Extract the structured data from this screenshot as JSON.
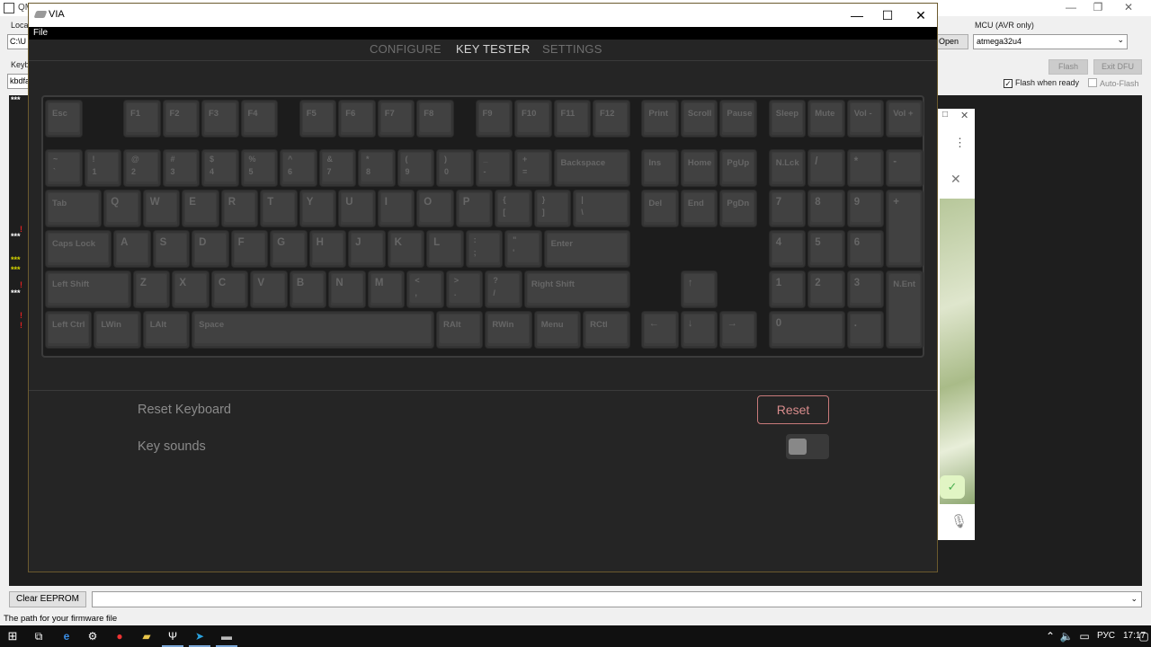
{
  "qmk": {
    "title": "QM",
    "label_local": "Loca",
    "path_value": "C:\\U",
    "label_keyboard": "Keyb",
    "keyboard_value": "kbdfa",
    "open_label": "Open",
    "mcu_label": "MCU (AVR only)",
    "mcu_value": "atmega32u4",
    "flash_label": "Flash",
    "exit_dfu_label": "Exit DFU",
    "flash_when_ready_label": "Flash when ready",
    "flash_when_ready_checked": true,
    "auto_flash_label": "Auto-Flash",
    "clear_eeprom_label": "Clear EEPROM",
    "status_text": "The path for your firmware file",
    "console_marks": [
      "***",
      "!",
      "***",
      "***",
      "***",
      "!",
      "***",
      "!",
      "!"
    ]
  },
  "via": {
    "title": "VIA",
    "menu_file": "File",
    "nav": [
      "CONFIGURE",
      "KEY TESTER",
      "SETTINGS"
    ],
    "active_tab": "KEY TESTER",
    "settings": {
      "reset_label": "Reset Keyboard",
      "reset_button": "Reset",
      "sounds_label": "Key sounds",
      "sounds_enabled": false
    }
  },
  "keyboard": {
    "rows": [
      [
        [
          "Esc"
        ],
        [
          "F1"
        ],
        [
          "F2"
        ],
        [
          "F3"
        ],
        [
          "F4"
        ],
        [
          "F5"
        ],
        [
          "F6"
        ],
        [
          "F7"
        ],
        [
          "F8"
        ],
        [
          "F9"
        ],
        [
          "F10"
        ],
        [
          "F11"
        ],
        [
          "F12"
        ],
        [
          "Print"
        ],
        [
          "Scroll"
        ],
        [
          "Pause"
        ],
        [
          "Sleep"
        ],
        [
          "Mute"
        ],
        [
          "Vol -"
        ],
        [
          "Vol +"
        ]
      ],
      [
        [
          "~",
          "`"
        ],
        [
          "!",
          "1"
        ],
        [
          "@",
          "2"
        ],
        [
          "#",
          "3"
        ],
        [
          "$",
          "4"
        ],
        [
          "%",
          "5"
        ],
        [
          "^",
          "6"
        ],
        [
          "&",
          "7"
        ],
        [
          "*",
          "8"
        ],
        [
          "(",
          "9"
        ],
        [
          ")",
          "0"
        ],
        [
          "_",
          "-"
        ],
        [
          "+",
          "="
        ],
        [
          "Backspace"
        ],
        [
          "Ins"
        ],
        [
          "Home"
        ],
        [
          "PgUp"
        ],
        [
          "N.Lck"
        ],
        [
          "/"
        ],
        [
          "*"
        ],
        [
          "-"
        ]
      ],
      [
        [
          "Tab"
        ],
        [
          "Q"
        ],
        [
          "W"
        ],
        [
          "E"
        ],
        [
          "R"
        ],
        [
          "T"
        ],
        [
          "Y"
        ],
        [
          "U"
        ],
        [
          "I"
        ],
        [
          "O"
        ],
        [
          "P"
        ],
        [
          "{",
          "["
        ],
        [
          "}",
          "]"
        ],
        [
          "|",
          "\\"
        ],
        [
          "Del"
        ],
        [
          "End"
        ],
        [
          "PgDn"
        ],
        [
          "7"
        ],
        [
          "8"
        ],
        [
          "9"
        ],
        [
          "+"
        ]
      ],
      [
        [
          "Caps Lock"
        ],
        [
          "A"
        ],
        [
          "S"
        ],
        [
          "D"
        ],
        [
          "F"
        ],
        [
          "G"
        ],
        [
          "H"
        ],
        [
          "J"
        ],
        [
          "K"
        ],
        [
          "L"
        ],
        [
          ":",
          ";"
        ],
        [
          "\"",
          "'"
        ],
        [
          "Enter"
        ],
        [
          "4"
        ],
        [
          "5"
        ],
        [
          "6"
        ]
      ],
      [
        [
          "Left Shift"
        ],
        [
          "Z"
        ],
        [
          "X"
        ],
        [
          "C"
        ],
        [
          "V"
        ],
        [
          "B"
        ],
        [
          "N"
        ],
        [
          "M"
        ],
        [
          "<",
          ","
        ],
        [
          ">",
          "."
        ],
        [
          "?",
          "/"
        ],
        [
          "Right Shift"
        ],
        [
          "↑"
        ],
        [
          "1"
        ],
        [
          "2"
        ],
        [
          "3"
        ],
        [
          "N.Ent"
        ]
      ],
      [
        [
          "Left Ctrl"
        ],
        [
          "LWin"
        ],
        [
          "LAlt"
        ],
        [
          "Space"
        ],
        [
          "RAlt"
        ],
        [
          "RWin"
        ],
        [
          "Menu"
        ],
        [
          "RCtl"
        ],
        [
          "←"
        ],
        [
          "↓"
        ],
        [
          "→"
        ],
        [
          "0"
        ],
        [
          "."
        ]
      ]
    ]
  },
  "taskbar": {
    "lang": "РУС",
    "time": "17:17"
  }
}
